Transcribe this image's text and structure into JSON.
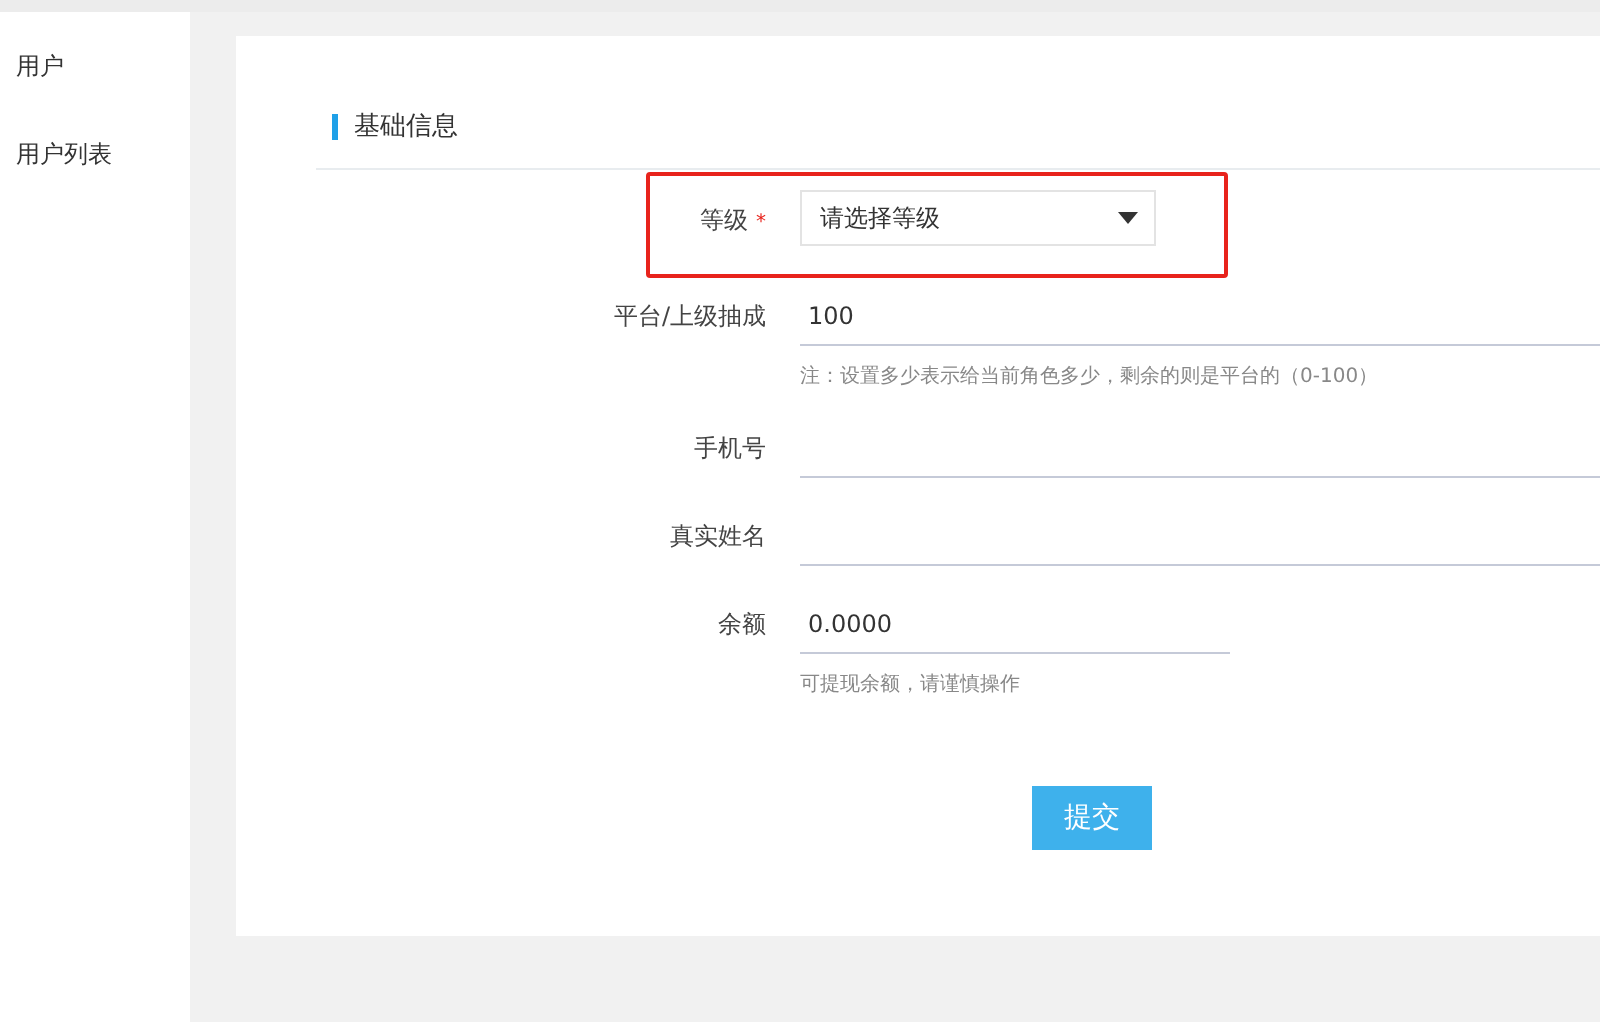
{
  "sidebar": {
    "items": [
      {
        "label": "用户",
        "selected": false
      },
      {
        "label": "用户列表",
        "selected": false
      }
    ]
  },
  "section": {
    "title": "基础信息"
  },
  "fields": [
    {
      "kind": "select",
      "label": "等级",
      "required_mark": "*",
      "placeholder": "请选择等级",
      "highlighted": true
    },
    {
      "kind": "text",
      "label": "平台/上级抽成",
      "value": "100",
      "hint": "注：设置多少表示给当前角色多少，剩余的则是平台的（0-100）",
      "highlighted": false
    },
    {
      "kind": "text",
      "label": "手机号",
      "highlighted": false
    },
    {
      "kind": "text",
      "label": "真实姓名",
      "highlighted": false
    },
    {
      "kind": "amount",
      "label": "余额",
      "value": "0.0000",
      "hint": "可提现余额，请谨慎操作",
      "highlighted": false
    }
  ],
  "submit": {
    "label": "提交"
  }
}
